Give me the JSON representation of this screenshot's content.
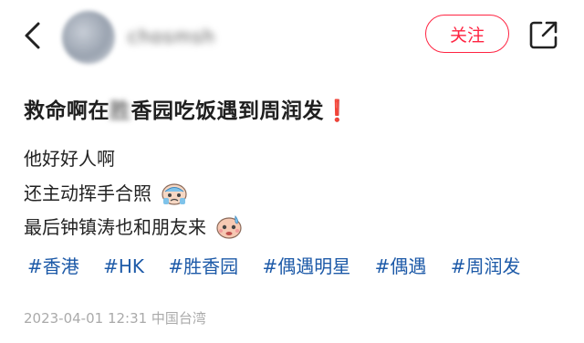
{
  "header": {
    "username": "chosmsh",
    "follow_label": "关注"
  },
  "post": {
    "title_before": "救命啊在",
    "title_blurred": "胜",
    "title_after": "香园吃饭遇到周润发",
    "title_mark": "❗",
    "lines": [
      "他好好人啊",
      "还主动挥手合照",
      "最后钟镇涛也和朋友来"
    ],
    "tags": [
      "#香港",
      "#HK",
      "#胜香园",
      "#偶遇明星",
      "#偶遇",
      "#周润发"
    ],
    "meta": "2023-04-01 12:31 中国台湾"
  },
  "icons": {
    "back": "chevron-left-icon",
    "share": "share-icon",
    "emoji1": "crying-emoji-icon",
    "emoji2": "sweating-emoji-icon"
  },
  "colors": {
    "accent": "#ff2442",
    "tag": "#1d5aa8",
    "meta": "#aaaaaa"
  }
}
